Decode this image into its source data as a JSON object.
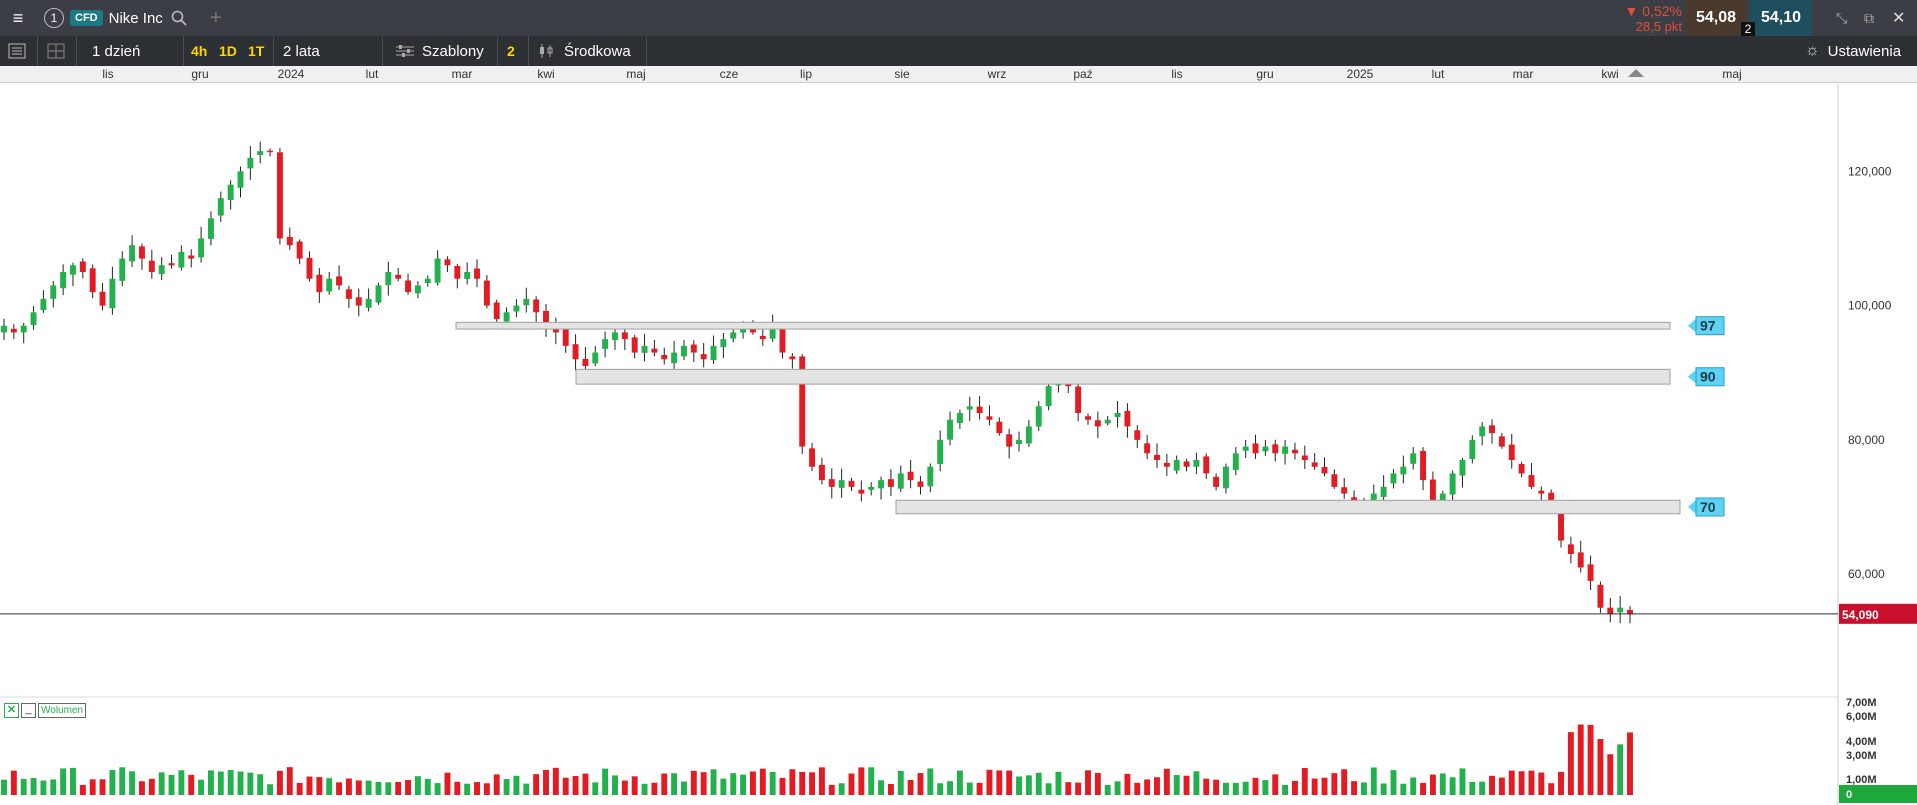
{
  "instrument": {
    "number": "1",
    "type": "CFD",
    "name": "Nike Inc"
  },
  "quote": {
    "change_pct": "▼ 0,52%",
    "change_pts": "28,5 pkt",
    "bid": "54,08",
    "ask": "54,10",
    "ask_badge": "2"
  },
  "toolbar": {
    "interval": "1 dzień",
    "quick_4h": "4h",
    "quick_1d": "1D",
    "quick_1t": "1T",
    "range": "2 lata",
    "templates": "Szablony",
    "templates_count": "2",
    "indicator": "Środkowa",
    "settings": "Ustawienia"
  },
  "colors": {
    "up": "#22b14c",
    "down": "#e31b23",
    "zone_fill": "#e4e4e4",
    "tag": "#5fd3f3",
    "last_price": "#c8102e"
  },
  "chart_data": {
    "type": "candlestick",
    "time_axis": [
      "lis",
      "gru",
      "2024",
      "lut",
      "mar",
      "kwi",
      "maj",
      "cze",
      "lip",
      "sie",
      "wrz",
      "paź",
      "lis",
      "gru",
      "2025",
      "lut",
      "mar",
      "kwi",
      "maj"
    ],
    "y_ticks": [
      "120,000",
      "100,000",
      "80,000",
      "60,000"
    ],
    "ylim": [
      42,
      133
    ],
    "last_price": "54,090",
    "closes": [
      97,
      96,
      97,
      99,
      101,
      103,
      105,
      106,
      105,
      102,
      100,
      104,
      107,
      109,
      107,
      105,
      106,
      106,
      108,
      107,
      110,
      113,
      116,
      118,
      120,
      122,
      123,
      123,
      110,
      109,
      107,
      104,
      102,
      104,
      103,
      101,
      100,
      101,
      103,
      105,
      104,
      102,
      103,
      104,
      107,
      106,
      104,
      105,
      104,
      100,
      98,
      99,
      100,
      101,
      99,
      97,
      96,
      94,
      92,
      91,
      93,
      95,
      96,
      95,
      93,
      94,
      93,
      92,
      93,
      94,
      93,
      92,
      94,
      95,
      96,
      97,
      96,
      95,
      97,
      93,
      92,
      79,
      76,
      74,
      73,
      74,
      73,
      72,
      73,
      74,
      73,
      75,
      74,
      73,
      76,
      80,
      83,
      84,
      85,
      84,
      83,
      81,
      79,
      80,
      82,
      85,
      88,
      89,
      88,
      84,
      83,
      82,
      83,
      84,
      82,
      80,
      78,
      77,
      76,
      77,
      76,
      77,
      75,
      73,
      76,
      78,
      79,
      78,
      79,
      78,
      79,
      78,
      77,
      76,
      75,
      73,
      72,
      71,
      71,
      72,
      73,
      75,
      76,
      78,
      74,
      70,
      72,
      75,
      77,
      80,
      82,
      81,
      79,
      77,
      75,
      73,
      72,
      70,
      65,
      63,
      61,
      59,
      55,
      54,
      55,
      54
    ],
    "volume": {
      "axis_ticks": [
        "7,00M",
        "6,00M",
        "4,00M",
        "3,00M",
        "1,00M",
        "0"
      ]
    },
    "zones": [
      {
        "tag": "97",
        "low": 96.5,
        "high": 97.5
      },
      {
        "tag": "90",
        "low": 88.3,
        "high": 90.5
      },
      {
        "tag": "70",
        "low": 69.0,
        "high": 71.0
      }
    ]
  },
  "volume_legend": {
    "label": "Wolumen"
  }
}
